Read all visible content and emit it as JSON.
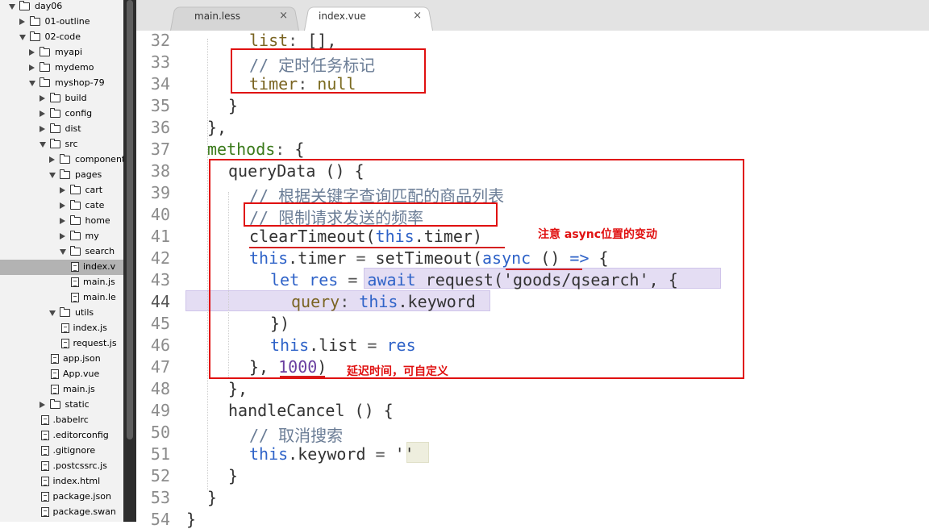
{
  "tree": [
    {
      "label": "day06",
      "depth": 0,
      "kind": "folder",
      "open": true
    },
    {
      "label": "01-outline",
      "depth": 1,
      "kind": "folder",
      "open": false
    },
    {
      "label": "02-code",
      "depth": 1,
      "kind": "folder",
      "open": true
    },
    {
      "label": "myapi",
      "depth": 2,
      "kind": "folder",
      "open": false
    },
    {
      "label": "mydemo",
      "depth": 2,
      "kind": "folder",
      "open": false
    },
    {
      "label": "myshop-79",
      "depth": 2,
      "kind": "folder",
      "open": true
    },
    {
      "label": "build",
      "depth": 3,
      "kind": "folder",
      "open": false
    },
    {
      "label": "config",
      "depth": 3,
      "kind": "folder",
      "open": false
    },
    {
      "label": "dist",
      "depth": 3,
      "kind": "folder",
      "open": false
    },
    {
      "label": "src",
      "depth": 3,
      "kind": "folder",
      "open": true
    },
    {
      "label": "component",
      "depth": 4,
      "kind": "folder",
      "open": false
    },
    {
      "label": "pages",
      "depth": 4,
      "kind": "folder",
      "open": true
    },
    {
      "label": "cart",
      "depth": 5,
      "kind": "folder",
      "open": false
    },
    {
      "label": "cate",
      "depth": 5,
      "kind": "folder",
      "open": false
    },
    {
      "label": "home",
      "depth": 5,
      "kind": "folder",
      "open": false
    },
    {
      "label": "my",
      "depth": 5,
      "kind": "folder",
      "open": false
    },
    {
      "label": "search",
      "depth": 5,
      "kind": "folder",
      "open": true
    },
    {
      "label": "index.v",
      "depth": 6,
      "kind": "file",
      "selected": true
    },
    {
      "label": "main.js",
      "depth": 6,
      "kind": "file"
    },
    {
      "label": "main.le",
      "depth": 6,
      "kind": "file"
    },
    {
      "label": "utils",
      "depth": 4,
      "kind": "folder",
      "open": true
    },
    {
      "label": "index.js",
      "depth": 5,
      "kind": "file"
    },
    {
      "label": "request.js",
      "depth": 5,
      "kind": "file"
    },
    {
      "label": "app.json",
      "depth": 4,
      "kind": "file"
    },
    {
      "label": "App.vue",
      "depth": 4,
      "kind": "file"
    },
    {
      "label": "main.js",
      "depth": 4,
      "kind": "file"
    },
    {
      "label": "static",
      "depth": 3,
      "kind": "folder",
      "open": false
    },
    {
      "label": ".babelrc",
      "depth": 3,
      "kind": "file"
    },
    {
      "label": ".editorconfig",
      "depth": 3,
      "kind": "file"
    },
    {
      "label": ".gitignore",
      "depth": 3,
      "kind": "file"
    },
    {
      "label": ".postcssrc.js",
      "depth": 3,
      "kind": "file"
    },
    {
      "label": "index.html",
      "depth": 3,
      "kind": "file"
    },
    {
      "label": "package.json",
      "depth": 3,
      "kind": "file"
    },
    {
      "label": "package.swan",
      "depth": 3,
      "kind": "file"
    }
  ],
  "tabs": [
    {
      "label": "main.less",
      "close": "×",
      "active": false
    },
    {
      "label": "index.vue",
      "close": "×",
      "active": true
    }
  ],
  "line_numbers": [
    "32",
    "33",
    "34",
    "35",
    "36",
    "37",
    "38",
    "39",
    "40",
    "41",
    "42",
    "43",
    "44",
    "45",
    "46",
    "47",
    "48",
    "49",
    "50",
    "51",
    "52",
    "53",
    "54"
  ],
  "code": {
    "l32": {
      "a": "list",
      "b": ":",
      "c": " [],"
    },
    "l33": {
      "a": "// 定时任务标记"
    },
    "l34": {
      "a": "timer",
      "b": ":",
      "c": " null"
    },
    "l35": {
      "a": "}"
    },
    "l36": {
      "a": "},"
    },
    "l37": {
      "a": "methods",
      "b": ":",
      "c": " {"
    },
    "l38": {
      "a": "queryData () {"
    },
    "l39": {
      "a": "// 根据关键字查询匹配的商品列表"
    },
    "l40": {
      "a": "// 限制请求发送的频率"
    },
    "l41": {
      "a": "clearTimeout(",
      "b": "this",
      "c": ".timer)"
    },
    "l42": {
      "a": "this",
      "b": ".timer ",
      "c": "=",
      "d": " setTimeout(",
      "e": "async",
      "f": " () ",
      "g": "=>",
      "h": " {"
    },
    "l43": {
      "a": "let",
      "b": " res ",
      "c": "=",
      "d": " await",
      "e": " request(",
      "f": "'goods/qsearch'",
      "g": ", {"
    },
    "l44": {
      "a": "query",
      "b": ":",
      "c": " this",
      "d": ".keyword"
    },
    "l45": {
      "a": "})"
    },
    "l46": {
      "a": "this",
      "b": ".list ",
      "c": "=",
      "d": " res"
    },
    "l47": {
      "a": "}, ",
      "b": "1000",
      "c": ")"
    },
    "l48": {
      "a": "},"
    },
    "l49": {
      "a": "handleCancel () {"
    },
    "l50": {
      "a": "// 取消搜索"
    },
    "l51": {
      "a": "this",
      "b": ".keyword ",
      "c": "=",
      "d": " ''"
    },
    "l52": {
      "a": "}"
    },
    "l53": {
      "a": "}"
    },
    "l54": {
      "a": "}"
    }
  },
  "annotations": {
    "async_note": "注意 async位置的变动",
    "delay_note": "延迟时间，可自定义"
  },
  "colors": {
    "annotation_red": "#e01010",
    "keyword_blue": "#2f63c8",
    "selection": "#e4ddf3"
  }
}
